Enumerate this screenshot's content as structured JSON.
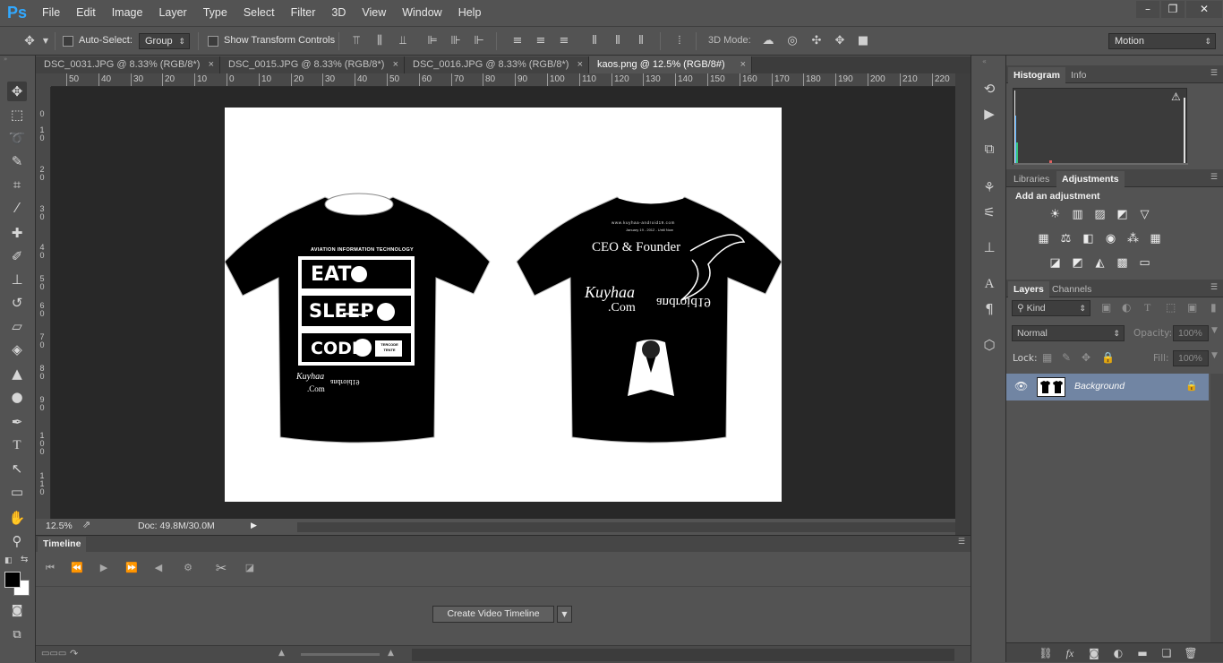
{
  "app": {
    "logo": "Ps",
    "menu": [
      "File",
      "Edit",
      "Image",
      "Layer",
      "Type",
      "Select",
      "Filter",
      "3D",
      "View",
      "Window",
      "Help"
    ],
    "window_controls": [
      "–",
      "❐",
      "✕"
    ]
  },
  "options_bar": {
    "auto_select_label": "Auto-Select:",
    "auto_select_value": "Group",
    "show_transform_label": "Show Transform Controls",
    "mode_3d_label": "3D Mode:",
    "workspace_value": "Motion"
  },
  "tabs": [
    {
      "label": "DSC_0031.JPG @ 8.33% (RGB/8*)",
      "close": "×"
    },
    {
      "label": "DSC_0015.JPG @ 8.33% (RGB/8*)",
      "close": "×"
    },
    {
      "label": "DSC_0016.JPG @ 8.33% (RGB/8*)",
      "close": "×"
    },
    {
      "label": "kaos.png @ 12.5% (RGB/8#)",
      "close": "×"
    }
  ],
  "ruler_top": [
    "50",
    "40",
    "30",
    "20",
    "10",
    "0",
    "10",
    "20",
    "30",
    "40",
    "50",
    "60",
    "70",
    "80",
    "90",
    "100",
    "110",
    "120",
    "130",
    "140",
    "150",
    "160",
    "170",
    "180",
    "190",
    "200",
    "210",
    "220"
  ],
  "ruler_left": [
    "0",
    "1 0",
    "2 0",
    "3 0",
    "4 0",
    "5 0",
    "6 0",
    "7 0",
    "8 0",
    "9 0",
    "1 0 0",
    "1 1 0"
  ],
  "status": {
    "zoom": "12.5%",
    "doc": "Doc: 49.8M/30.0M"
  },
  "timeline": {
    "tab_label": "Timeline",
    "create_button": "Create Video Timeline"
  },
  "shirt_front": {
    "header": "AVIATION INFORMATION TECHNOLOGY",
    "words": [
      "EAT",
      "SLEEP",
      "CODE"
    ],
    "badge": "TERCODE TENTE",
    "logo_main": "Kuyhaa",
    "logo_sub": ".Com",
    "logo_mirror": "android19"
  },
  "shirt_back": {
    "url_line": "www.kuyhaa-android19.com",
    "date_line": "January 19 - 2012 - Until Now",
    "title": "CEO & Founder",
    "logo_main": "Kuyhaa",
    "logo_sub": ".Com",
    "logo_mirror": "android19"
  },
  "panels": {
    "histogram_tabs": [
      "Histogram",
      "Info"
    ],
    "warning_icon": "⚠",
    "adjust_tabs": [
      "Libraries",
      "Adjustments"
    ],
    "adjust_title": "Add an adjustment",
    "layers_tabs": [
      "Layers",
      "Channels"
    ],
    "kind_label": "Kind",
    "blend_mode": "Normal",
    "opacity_label": "Opacity:",
    "opacity_value": "100%",
    "lock_label": "Lock:",
    "fill_label": "Fill:",
    "fill_value": "100%",
    "layer_name": "Background"
  },
  "colors": {
    "ps_blue": "#31a8ff",
    "selected_layer": "#7185a3",
    "canvas_bg": "#282828",
    "ui_bg": "#535353"
  }
}
